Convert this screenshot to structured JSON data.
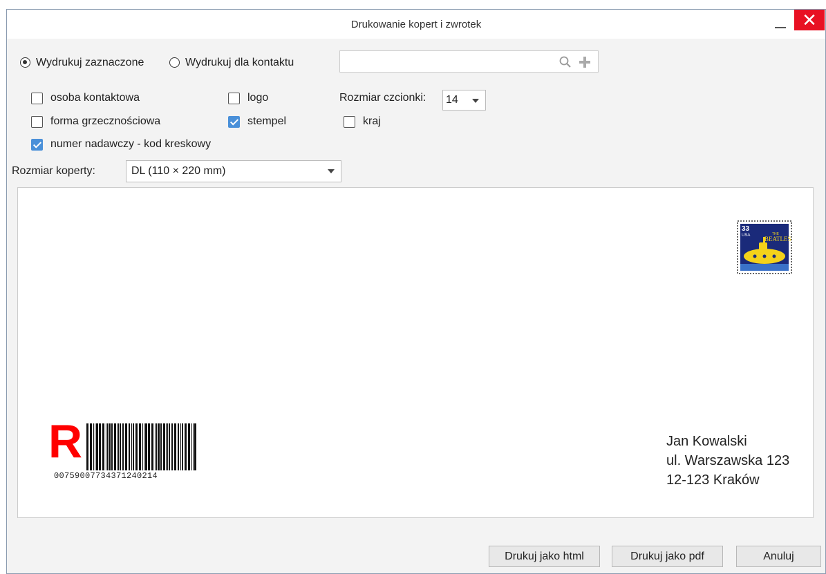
{
  "window": {
    "title": "Drukowanie kopert i zwrotek",
    "close_glyph": "✕"
  },
  "print_mode": {
    "options": [
      {
        "label": "Wydrukuj zaznaczone",
        "selected": true
      },
      {
        "label": "Wydrukuj dla kontaktu",
        "selected": false
      }
    ]
  },
  "contact_search": {
    "value": "",
    "icons": [
      "search-icon",
      "add-icon"
    ]
  },
  "options": {
    "osoba_kontaktowa": {
      "label": "osoba kontaktowa",
      "checked": false
    },
    "forma_grzecznosciowa": {
      "label": "forma grzecznościowa",
      "checked": false
    },
    "numer_nadawczy": {
      "label": "numer nadawczy - kod kreskowy",
      "checked": true
    },
    "logo": {
      "label": "logo",
      "checked": false
    },
    "stempel": {
      "label": "stempel",
      "checked": true
    },
    "kraj": {
      "label": "kraj",
      "checked": false
    }
  },
  "font_size": {
    "label": "Rozmiar czcionki:",
    "value": "14"
  },
  "envelope_size": {
    "label": "Rozmiar koperty:",
    "value": "DL (110 × 220 mm)"
  },
  "envelope": {
    "registered_mark": "R",
    "tracking_number": "00759007734371240214",
    "stamp": {
      "value": "33",
      "country": "USA",
      "band_small": "THE",
      "band": "BEATLES"
    },
    "address": {
      "line1": "Jan Kowalski",
      "line2": "ul. Warszawska 123",
      "line3": "12-123 Kraków"
    }
  },
  "buttons": {
    "html": "Drukuj jako html",
    "pdf": "Drukuj jako pdf",
    "cancel": "Anuluj"
  },
  "colors": {
    "accent": "#4a90d9",
    "close": "#e81123",
    "registered": "#ff0000"
  }
}
